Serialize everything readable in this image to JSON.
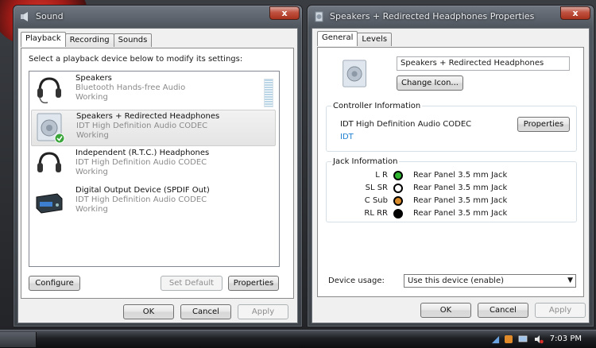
{
  "sound_window": {
    "title": "Sound",
    "close_glyph": "x",
    "tabs": [
      {
        "label": "Playback",
        "active": true
      },
      {
        "label": "Recording",
        "active": false
      },
      {
        "label": "Sounds",
        "active": false
      }
    ],
    "instruction": "Select a playback device below to modify its settings:",
    "devices": [
      {
        "name": "Speakers",
        "description": "Bluetooth Hands-free Audio",
        "status": "Working",
        "icon": "headphones-icon",
        "selected": false,
        "default": false
      },
      {
        "name": "Speakers + Redirected Headphones",
        "description": "IDT High Definition Audio CODEC",
        "status": "Working",
        "icon": "speaker-icon",
        "selected": true,
        "default": true
      },
      {
        "name": "Independent (R.T.C.) Headphones",
        "description": "IDT High Definition Audio CODEC",
        "status": "Working",
        "icon": "headphones-icon",
        "selected": false,
        "default": false
      },
      {
        "name": "Digital Output Device (SPDIF Out)",
        "description": "IDT High Definition Audio CODEC",
        "status": "Working",
        "icon": "digital-output-icon",
        "selected": false,
        "default": false
      }
    ],
    "buttons": {
      "configure": "Configure",
      "set_default": "Set Default",
      "properties": "Properties",
      "ok": "OK",
      "cancel": "Cancel",
      "apply": "Apply"
    }
  },
  "props_window": {
    "title": "Speakers + Redirected Headphones Properties",
    "close_glyph": "x",
    "tabs": [
      {
        "label": "General",
        "active": true
      },
      {
        "label": "Levels",
        "active": false
      }
    ],
    "device_name_value": "Speakers + Redirected Headphones",
    "change_icon": "Change Icon...",
    "controller": {
      "legend": "Controller Information",
      "name": "IDT High Definition Audio CODEC",
      "vendor": "IDT",
      "properties": "Properties"
    },
    "jack": {
      "legend": "Jack Information",
      "rows": [
        {
          "channel": "L R",
          "color": "#2fb52f",
          "label": "Rear Panel 3.5 mm Jack"
        },
        {
          "channel": "SL SR",
          "color": "#ffffff",
          "label": "Rear Panel 3.5 mm Jack"
        },
        {
          "channel": "C Sub",
          "color": "#d98c2b",
          "label": "Rear Panel 3.5 mm Jack"
        },
        {
          "channel": "RL RR",
          "color": "#000000",
          "label": "Rear Panel 3.5 mm Jack"
        }
      ]
    },
    "device_usage_label": "Device usage:",
    "device_usage_value": "Use this device (enable)",
    "buttons": {
      "ok": "OK",
      "cancel": "Cancel",
      "apply": "Apply"
    }
  },
  "taskbar": {
    "clock": "7:03 PM"
  },
  "colors": {
    "accent_link": "#1f7fd1",
    "default_check": "#3aa53a"
  }
}
